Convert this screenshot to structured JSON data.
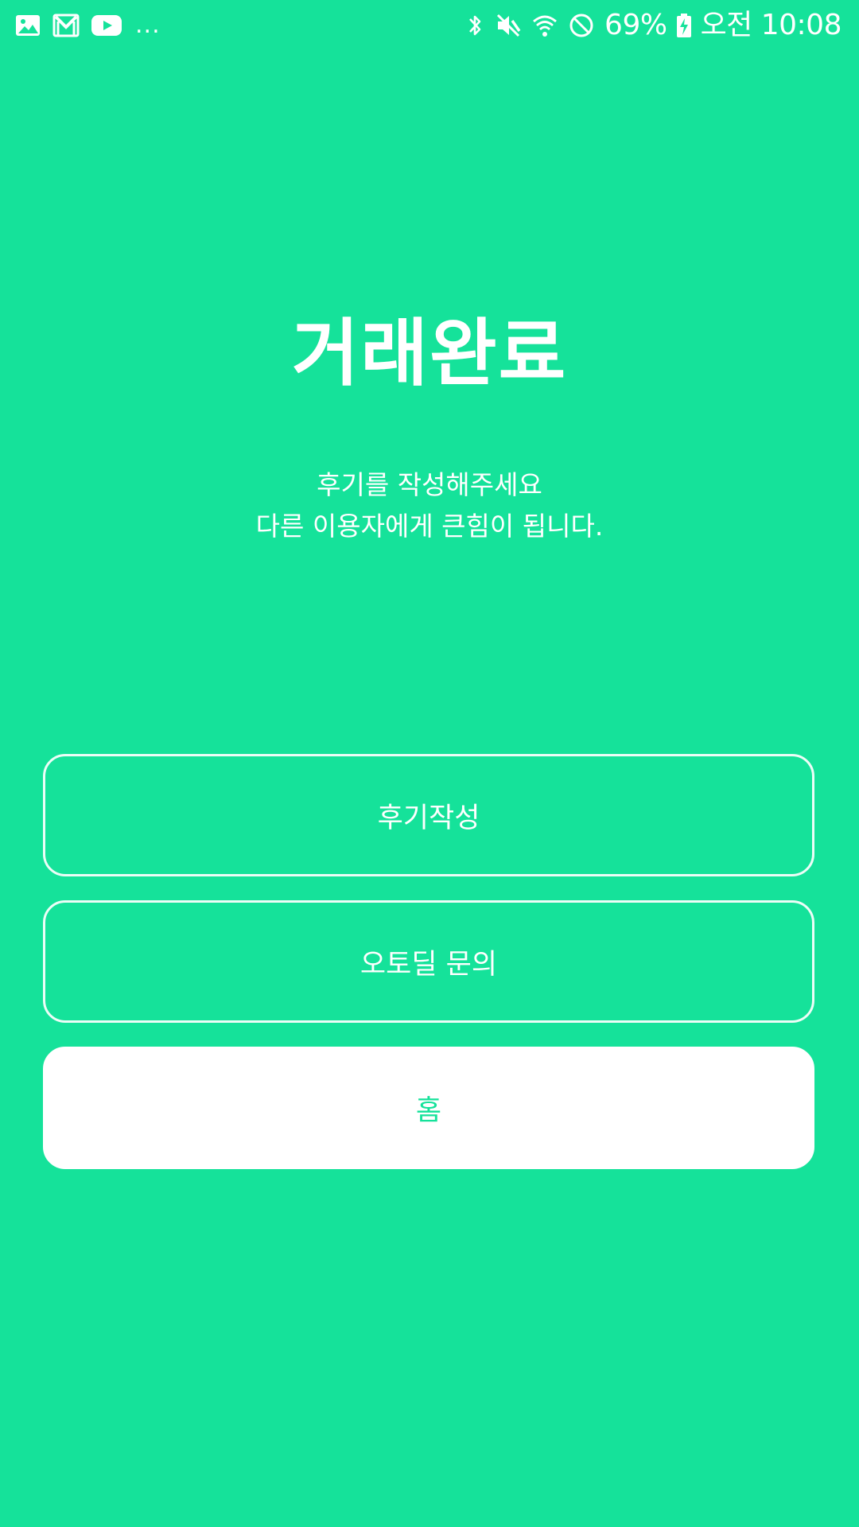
{
  "status_bar": {
    "notification_icons": [
      "gallery-icon",
      "gmail-icon",
      "youtube-icon"
    ],
    "more_indicator": "...",
    "system_icons": [
      "bluetooth-icon",
      "mute-icon",
      "wifi-icon",
      "do-not-disturb-icon"
    ],
    "battery_percent": "69%",
    "time": "오전 10:08"
  },
  "main": {
    "title": "거래완료",
    "subtitle_line1": "후기를 작성해주세요",
    "subtitle_line2": "다른 이용자에게 큰힘이 됩니다."
  },
  "buttons": {
    "write_review": "후기작성",
    "inquiry": "오토딜 문의",
    "home": "홈"
  },
  "colors": {
    "background": "#15e29a",
    "foreground": "#ffffff"
  }
}
